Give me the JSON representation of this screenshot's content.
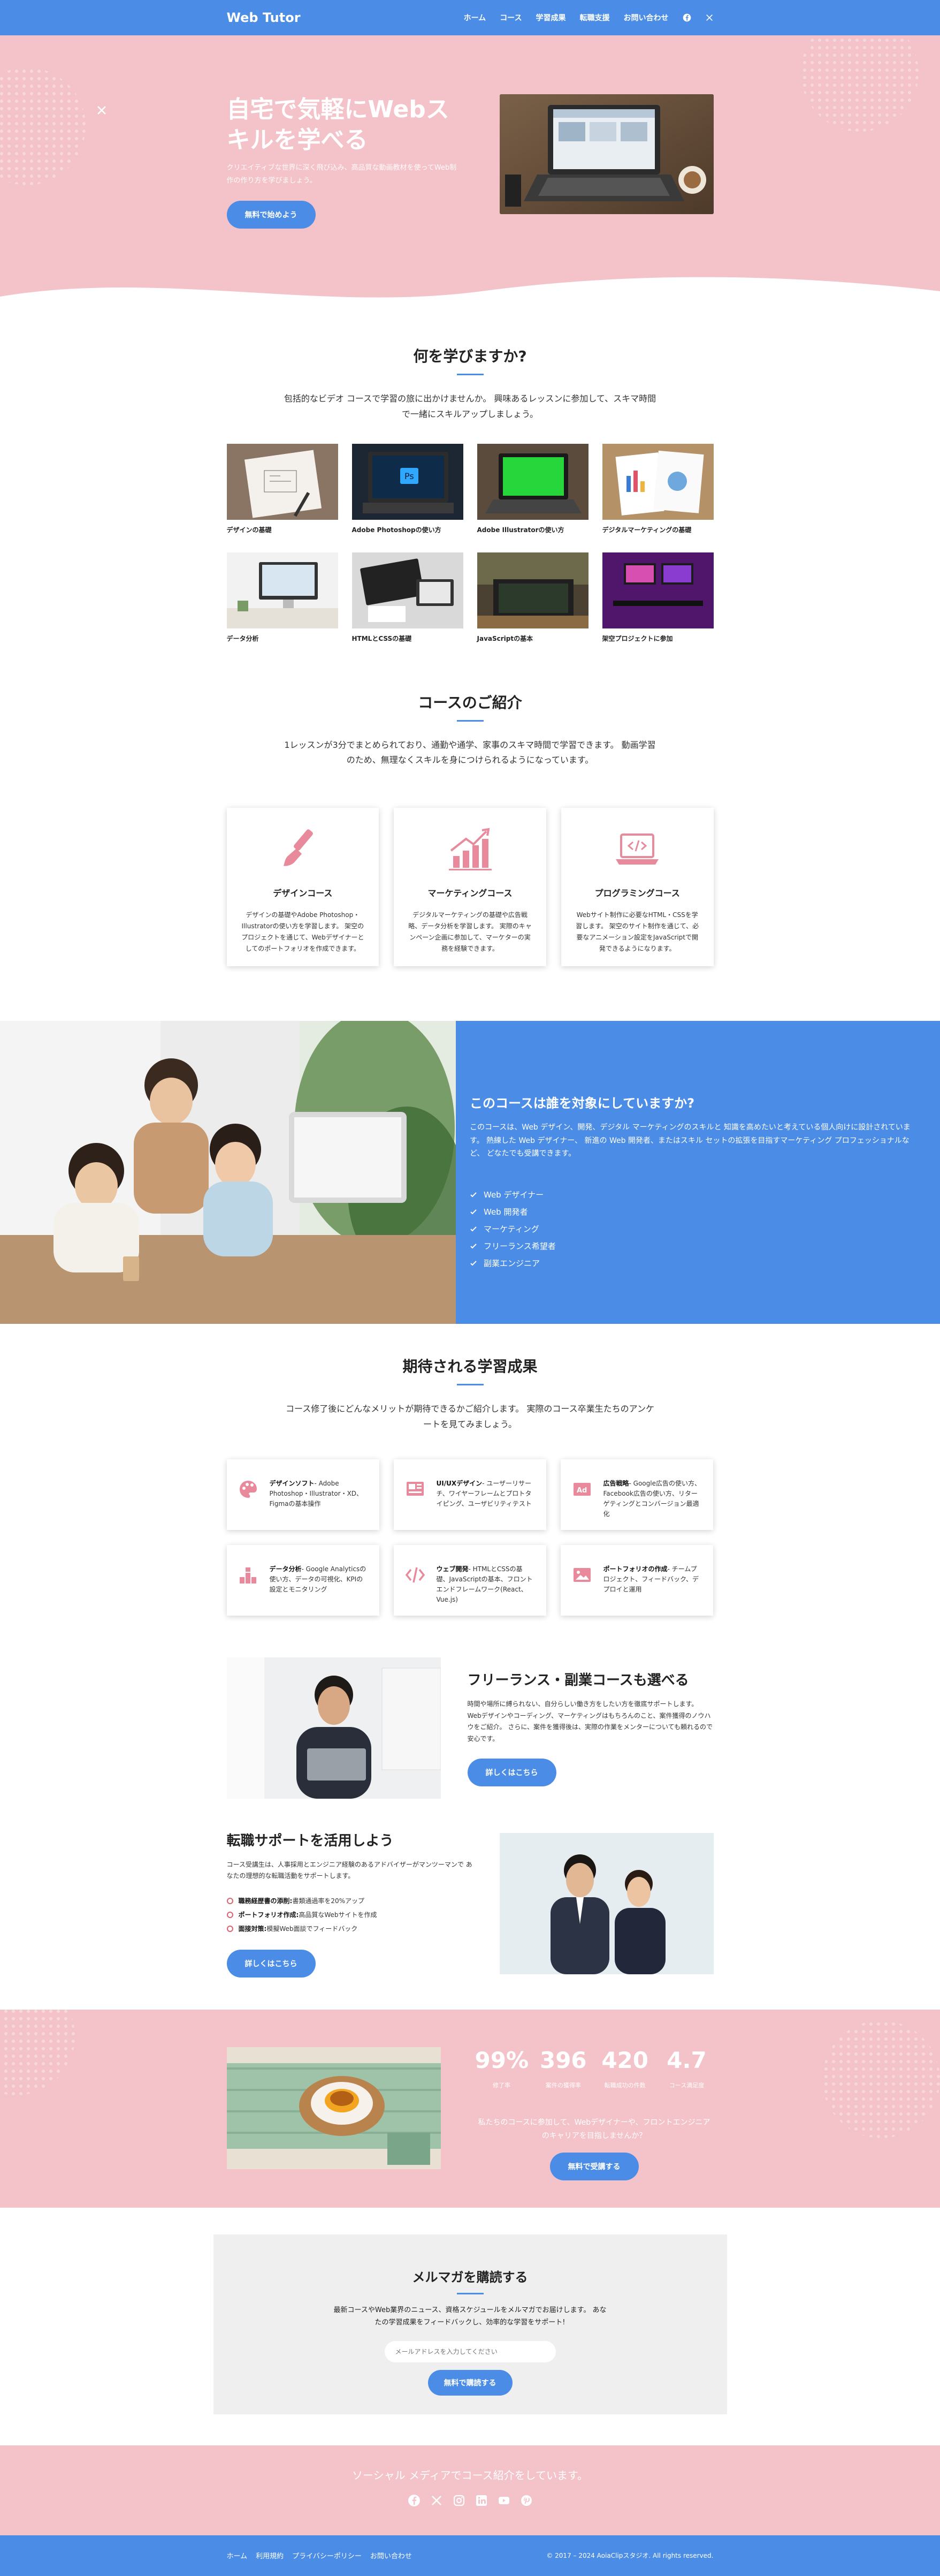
{
  "nav": {
    "brand": "Web Tutor",
    "items": [
      "ホーム",
      "コース",
      "学習成果",
      "転職支援",
      "お問い合わせ"
    ]
  },
  "hero": {
    "title": "自宅で気軽にWebスキルを学べる",
    "desc": "クリエイティブな世界に深く飛び込み、高品質な動画教材を使ってWeb制作の作り方を学びましょう。",
    "cta": "無料で始めよう"
  },
  "learn": {
    "title": "何を学びますか?",
    "desc": "包括的なビデオ コースで学習の旅に出かけませんか。 興味あるレッスンに参加して、スキマ時間で一緒にスキルアップしましょう。",
    "items": [
      "デザインの基礎",
      "Adobe Photoshopの使い方",
      "Adobe Illustratorの使い方",
      "デジタルマーケティングの基礎",
      "データ分析",
      "HTMLとCSSの基礎",
      "JavaScriptの基本",
      "架空プロジェクトに参加"
    ]
  },
  "courses": {
    "title": "コースのご紹介",
    "desc": "1レッスンが3分でまとめられており、通勤や通学、家事のスキマ時間で学習できます。 動画学習のため、無理なくスキルを身につけられるようになっています。",
    "cards": [
      {
        "title": "デザインコース",
        "desc": "デザインの基礎やAdobe Photoshop・Illustratorの使い方を学習します。 架空のプロジェクトを通じて、Webデザイナーとしてのポートフォリオを作成できます。"
      },
      {
        "title": "マーケティングコース",
        "desc": "デジタルマーケティングの基礎や広告戦略、データ分析を学習します。 実際のキャンペーン企画に参加して、マーケターの実務を経験できます。"
      },
      {
        "title": "プログラミングコース",
        "desc": "Webサイト制作に必要なHTML・CSSを学習します。 架空のサイト制作を通じて、必要なアニメーション設定をJavaScriptで開発できるようになります。"
      }
    ]
  },
  "target": {
    "title": "このコースは誰を対象にしていますか?",
    "desc": "このコースは、Web デザイン、開発、デジタル マーケティングのスキルと 知識を高めたいと考えている個人向けに設計されています。 熱練した Web デザイナー、 新進の Web 開発者、またはスキル セットの拡張を目指すマーケティング プロフェッショナルなど、 どなたでも受講できます。",
    "list": [
      "Web デザイナー",
      "Web 開発者",
      "マーケティング",
      "フリーランス希望者",
      "副業エンジニア"
    ]
  },
  "outcomes": {
    "title": "期待される学習成果",
    "desc": "コース修了後にどんなメリットが期待できるかご紹介します。 実際のコース卒業生たちのアンケートを見てみましょう。",
    "cards": [
      {
        "icon": "palette-icon",
        "title": "デザインソフト",
        "text": "- Adobe Photoshop・Illustrator・XD、Figmaの基本操作"
      },
      {
        "icon": "wireframe-icon",
        "title": "UI/UXデザイン",
        "text": "- ユーザーリサーチ、ワイヤーフレームとプロトタイピング、ユーザビリティテスト"
      },
      {
        "icon": "ad-icon",
        "title": "広告戦略",
        "text": "- Google広告の使い方、Facebook広告の使い方、リターゲティングとコンバージョン最適化"
      },
      {
        "icon": "data-icon",
        "title": "データ分析",
        "text": "- Google Analyticsの使い方、データの可視化、KPIの設定とモニタリング"
      },
      {
        "icon": "code-icon",
        "title": "ウェブ開発",
        "text": "- HTMLとCSSの基礎、JavaScriptの基本、フロントエンドフレームワーク(React、Vue.js)"
      },
      {
        "icon": "image-icon",
        "title": "ポートフォリオの作成",
        "text": "- チームプロジェクト、フィードバック、デプロイと運用"
      }
    ]
  },
  "freelance": {
    "title": "フリーランス・副業コースも選べる",
    "desc": "時間や場所に縛られない、自分らしい働き方をしたい方を徹底サポートします。 Webデザインやコーディング、マーケティングはもちろんのこと、案件獲得のノウハウをご紹介。 さらに、案件を獲得後は、実際の作業をメンターについても頼れるので安心です。",
    "cta": "詳しくはこちら"
  },
  "career": {
    "title": "転職サポートを活用しよう",
    "desc": "コース受講生は、人事採用とエンジニア経験のあるアドバイザーがマンツーマンで あなたの理想的な転職活動をサポートします。",
    "list": [
      {
        "b": "職務経歴書の添削:",
        "t": "書類通過率を20%アップ"
      },
      {
        "b": "ポートフォリオ作成:",
        "t": "高品質なWebサイトを作成"
      },
      {
        "b": "面接対策:",
        "t": "模擬Web面談でフィードバック"
      }
    ],
    "cta": "詳しくはこちら"
  },
  "stats": {
    "items": [
      {
        "n": "99%",
        "l": "修了率"
      },
      {
        "n": "396",
        "l": "案件の獲得率"
      },
      {
        "n": "420",
        "l": "転職成功の件数"
      },
      {
        "n": "4.7",
        "l": "コース満足度"
      }
    ],
    "desc": "私たちのコースに参加して、Webデザイナーや、フロントエンジニアのキャリアを目指しませんか？",
    "cta": "無料で受講する"
  },
  "newsletter": {
    "title": "メルマガを購読する",
    "desc": "最新コースやWeb業界のニュース、資格スケジュールをメルマガでお届けします。 あなたの学習成果をフィードバックし、効率的な学習をサポート!",
    "placeholder": "メールアドレスを入力してください",
    "cta": "無料で購読する"
  },
  "social": {
    "text": "ソーシャル メディアでコース紹介をしています。",
    "icons": [
      "facebook-icon",
      "x-icon",
      "instagram-icon",
      "linkedin-icon",
      "youtube-icon",
      "pinterest-icon"
    ]
  },
  "footer": {
    "links": [
      "ホーム",
      "利用規約",
      "プライバシーポリシー",
      "お問い合わせ"
    ],
    "copyright": "© 2017 – 2024 AoiaClipスタジオ. All rights reserved."
  },
  "colors": {
    "accent": "#4b8de6",
    "pink": "#f4c2c9",
    "icon_pink": "#e88a9c"
  }
}
